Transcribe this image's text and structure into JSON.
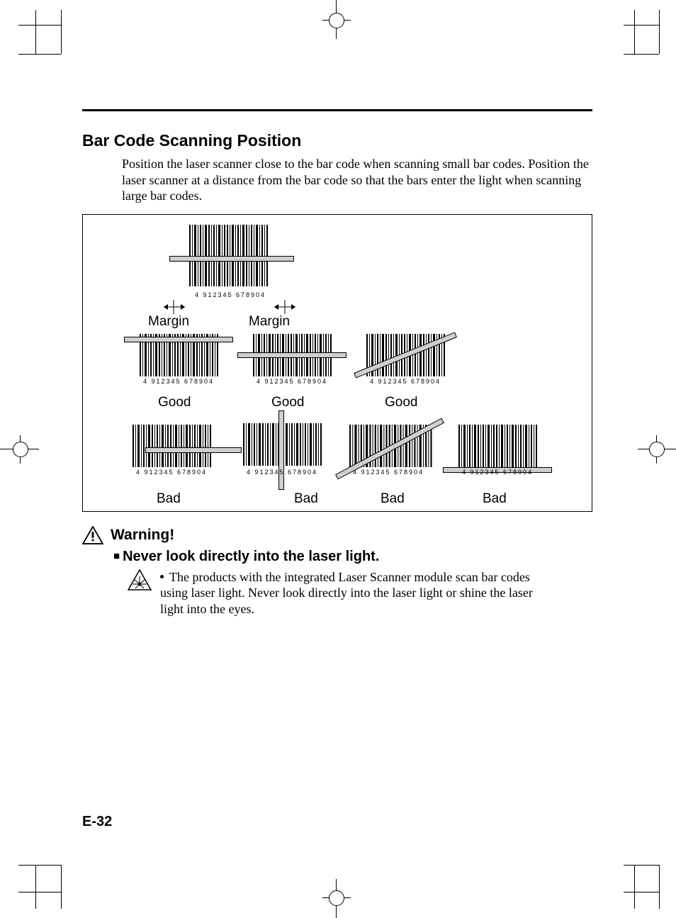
{
  "section_title": "Bar Code Scanning Position",
  "body_text": "Position the laser scanner close to the bar code when scanning small bar codes. Position the laser scanner at a distance from the bar code so that the bars enter the light when scanning large bar codes.",
  "figure": {
    "barcode_number": "4  912345 678904",
    "margin_label": "Margin",
    "good_label": "Good",
    "bad_label": "Bad"
  },
  "warning": {
    "title": "Warning!",
    "headline": "Never look directly into the laser light.",
    "bullet": "The products with the integrated Laser Scanner module scan bar codes using laser light.  Never look directly into the laser light or shine the laser light into the eyes."
  },
  "page_number": "E-32"
}
